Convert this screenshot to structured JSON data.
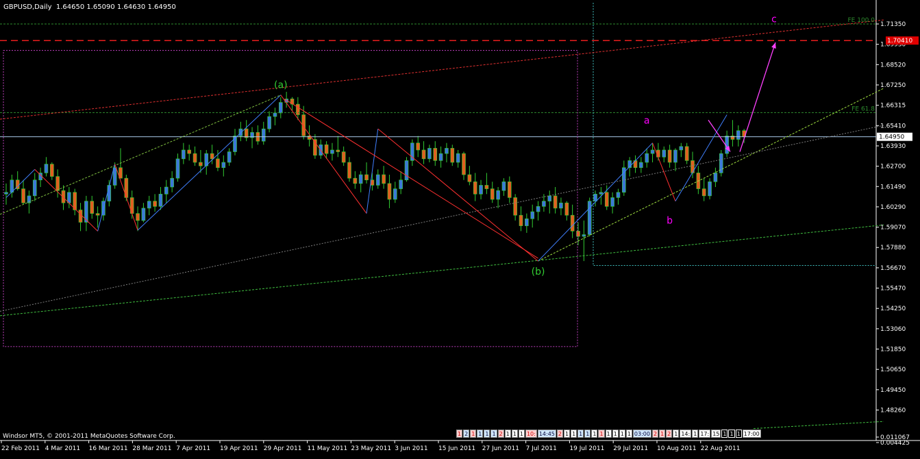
{
  "header": {
    "symbol_label": "GBPUSD,Daily",
    "ohlc_text": "1.64650 1.65090 1.64630 1.64950"
  },
  "footer": {
    "copyright": "Windsor MT5, © 2001-2011 MetaQuotes Software Corp."
  },
  "chart_data": {
    "type": "candlestick",
    "symbol": "GBPUSD",
    "timeframe": "Daily",
    "ylim": [
      1.486,
      1.72
    ],
    "y_ticks": [
      "1.71350",
      "1.69930",
      "1.68520",
      "1.67250",
      "1.66315",
      "1.65410",
      "1.63930",
      "1.62700",
      "1.61490",
      "1.60290",
      "1.59070",
      "1.57880",
      "1.56670",
      "1.55470",
      "1.54250",
      "1.53060",
      "1.51850",
      "1.50650",
      "1.49450",
      "1.48260",
      "0.011067",
      "0.004425"
    ],
    "x_tick_labels": [
      "22 Feb 2011",
      "4 Mar 2011",
      "16 Mar 2011",
      "28 Mar 2011",
      "7 Apr 2011",
      "19 Apr 2011",
      "29 Apr 2011",
      "11 May 2011",
      "23 May 2011",
      "3 Jun 2011",
      "15 Jun 2011",
      "27 Jun 2011",
      "7 Jul 2011",
      "19 Jul 2011",
      "29 Jul 2011",
      "10 Aug 2011",
      "22 Aug 2011"
    ],
    "last_price_label": "1.64950",
    "last_price": 1.6495,
    "level_labels": [
      {
        "text": "FE 100.0",
        "value": 1.7135
      },
      {
        "text": "FE 61.8",
        "value": 1.6632
      },
      {
        "text": "1.70410",
        "value": 1.7041
      }
    ],
    "wave_labels": [
      {
        "text": "(a)",
        "date": "27 Apr 2011",
        "price": 1.6732,
        "color": "#32cd32"
      },
      {
        "text": "(b)",
        "date": "7 Jul 2011",
        "price": 1.579,
        "color": "#32cd32"
      },
      {
        "text": "a",
        "date": "29 Jul 2011",
        "price": 1.657,
        "color": "#ff00ff"
      },
      {
        "text": "b",
        "date": "11 Aug 2011",
        "price": 1.6025,
        "color": "#ff00ff"
      },
      {
        "text": "c",
        "date": "1 Sep 2011",
        "price": 1.7145,
        "color": "#ff00ff"
      }
    ],
    "ohlc": [
      [
        1.617,
        1.623,
        1.611,
        1.618
      ],
      [
        1.618,
        1.628,
        1.615,
        1.625
      ],
      [
        1.625,
        1.63,
        1.619,
        1.62
      ],
      [
        1.62,
        1.625,
        1.611,
        1.612
      ],
      [
        1.612,
        1.619,
        1.606,
        1.616
      ],
      [
        1.616,
        1.629,
        1.613,
        1.625
      ],
      [
        1.625,
        1.632,
        1.621,
        1.629
      ],
      [
        1.629,
        1.638,
        1.627,
        1.634
      ],
      [
        1.634,
        1.635,
        1.625,
        1.627
      ],
      [
        1.627,
        1.631,
        1.615,
        1.619
      ],
      [
        1.619,
        1.622,
        1.608,
        1.612
      ],
      [
        1.612,
        1.621,
        1.609,
        1.618
      ],
      [
        1.618,
        1.62,
        1.605,
        1.608
      ],
      [
        1.608,
        1.612,
        1.596,
        1.601
      ],
      [
        1.601,
        1.616,
        1.596,
        1.613
      ],
      [
        1.613,
        1.616,
        1.603,
        1.606
      ],
      [
        1.606,
        1.61,
        1.598,
        1.605
      ],
      [
        1.605,
        1.615,
        1.602,
        1.613
      ],
      [
        1.613,
        1.625,
        1.61,
        1.622
      ],
      [
        1.622,
        1.635,
        1.62,
        1.632
      ],
      [
        1.632,
        1.643,
        1.629,
        1.626
      ],
      [
        1.626,
        1.628,
        1.613,
        1.615
      ],
      [
        1.615,
        1.619,
        1.603,
        1.606
      ],
      [
        1.606,
        1.61,
        1.596,
        1.602
      ],
      [
        1.602,
        1.612,
        1.601,
        1.609
      ],
      [
        1.609,
        1.616,
        1.605,
        1.613
      ],
      [
        1.613,
        1.617,
        1.607,
        1.61
      ],
      [
        1.61,
        1.621,
        1.608,
        1.617
      ],
      [
        1.617,
        1.625,
        1.612,
        1.621
      ],
      [
        1.621,
        1.63,
        1.618,
        1.626
      ],
      [
        1.626,
        1.64,
        1.624,
        1.637
      ],
      [
        1.637,
        1.646,
        1.634,
        1.642
      ],
      [
        1.642,
        1.645,
        1.636,
        1.64
      ],
      [
        1.64,
        1.644,
        1.633,
        1.635
      ],
      [
        1.635,
        1.642,
        1.629,
        1.633
      ],
      [
        1.633,
        1.642,
        1.628,
        1.64
      ],
      [
        1.64,
        1.645,
        1.634,
        1.637
      ],
      [
        1.637,
        1.642,
        1.63,
        1.632
      ],
      [
        1.632,
        1.639,
        1.627,
        1.635
      ],
      [
        1.635,
        1.643,
        1.633,
        1.641
      ],
      [
        1.641,
        1.654,
        1.639,
        1.65
      ],
      [
        1.65,
        1.658,
        1.647,
        1.654
      ],
      [
        1.654,
        1.659,
        1.647,
        1.649
      ],
      [
        1.649,
        1.655,
        1.643,
        1.652
      ],
      [
        1.652,
        1.656,
        1.645,
        1.647
      ],
      [
        1.647,
        1.658,
        1.645,
        1.654
      ],
      [
        1.654,
        1.664,
        1.652,
        1.661
      ],
      [
        1.661,
        1.666,
        1.656,
        1.663
      ],
      [
        1.663,
        1.672,
        1.66,
        1.669
      ],
      [
        1.669,
        1.675,
        1.666,
        1.671
      ],
      [
        1.671,
        1.672,
        1.664,
        1.668
      ],
      [
        1.668,
        1.672,
        1.659,
        1.662
      ],
      [
        1.662,
        1.667,
        1.648,
        1.65
      ],
      [
        1.65,
        1.656,
        1.644,
        1.648
      ],
      [
        1.648,
        1.651,
        1.637,
        1.639
      ],
      [
        1.639,
        1.648,
        1.637,
        1.645
      ],
      [
        1.645,
        1.647,
        1.637,
        1.64
      ],
      [
        1.64,
        1.646,
        1.636,
        1.642
      ],
      [
        1.642,
        1.65,
        1.638,
        1.641
      ],
      [
        1.641,
        1.644,
        1.633,
        1.635
      ],
      [
        1.635,
        1.638,
        1.624,
        1.626
      ],
      [
        1.626,
        1.63,
        1.62,
        1.623
      ],
      [
        1.623,
        1.63,
        1.618,
        1.628
      ],
      [
        1.628,
        1.635,
        1.623,
        1.625
      ],
      [
        1.625,
        1.629,
        1.619,
        1.622
      ],
      [
        1.622,
        1.631,
        1.62,
        1.628
      ],
      [
        1.628,
        1.633,
        1.62,
        1.623
      ],
      [
        1.623,
        1.628,
        1.609,
        1.614
      ],
      [
        1.614,
        1.624,
        1.612,
        1.62
      ],
      [
        1.62,
        1.63,
        1.617,
        1.625
      ],
      [
        1.625,
        1.638,
        1.624,
        1.636
      ],
      [
        1.636,
        1.648,
        1.633,
        1.646
      ],
      [
        1.646,
        1.65,
        1.638,
        1.642
      ],
      [
        1.642,
        1.647,
        1.634,
        1.637
      ],
      [
        1.637,
        1.645,
        1.635,
        1.643
      ],
      [
        1.643,
        1.647,
        1.633,
        1.636
      ],
      [
        1.636,
        1.644,
        1.632,
        1.64
      ],
      [
        1.64,
        1.646,
        1.635,
        1.643
      ],
      [
        1.643,
        1.645,
        1.633,
        1.635
      ],
      [
        1.635,
        1.642,
        1.632,
        1.64
      ],
      [
        1.64,
        1.641,
        1.625,
        1.628
      ],
      [
        1.628,
        1.633,
        1.622,
        1.624
      ],
      [
        1.624,
        1.629,
        1.613,
        1.617
      ],
      [
        1.617,
        1.625,
        1.614,
        1.622
      ],
      [
        1.622,
        1.629,
        1.617,
        1.62
      ],
      [
        1.62,
        1.624,
        1.612,
        1.614
      ],
      [
        1.614,
        1.621,
        1.609,
        1.619
      ],
      [
        1.619,
        1.626,
        1.616,
        1.624
      ],
      [
        1.624,
        1.627,
        1.612,
        1.615
      ],
      [
        1.615,
        1.617,
        1.602,
        1.605
      ],
      [
        1.605,
        1.61,
        1.596,
        1.599
      ],
      [
        1.599,
        1.606,
        1.595,
        1.603
      ],
      [
        1.603,
        1.611,
        1.598,
        1.607
      ],
      [
        1.607,
        1.613,
        1.602,
        1.61
      ],
      [
        1.61,
        1.617,
        1.607,
        1.613
      ],
      [
        1.613,
        1.619,
        1.606,
        1.616
      ],
      [
        1.616,
        1.621,
        1.606,
        1.609
      ],
      [
        1.609,
        1.615,
        1.605,
        1.612
      ],
      [
        1.612,
        1.613,
        1.602,
        1.605
      ],
      [
        1.605,
        1.611,
        1.592,
        1.596
      ],
      [
        1.596,
        1.601,
        1.588,
        1.593
      ],
      [
        1.593,
        1.602,
        1.579,
        1.594
      ],
      [
        1.594,
        1.615,
        1.593,
        1.613
      ],
      [
        1.613,
        1.619,
        1.61,
        1.617
      ],
      [
        1.617,
        1.621,
        1.611,
        1.618
      ],
      [
        1.618,
        1.622,
        1.608,
        1.61
      ],
      [
        1.61,
        1.618,
        1.606,
        1.615
      ],
      [
        1.615,
        1.62,
        1.611,
        1.618
      ],
      [
        1.618,
        1.636,
        1.616,
        1.632
      ],
      [
        1.632,
        1.638,
        1.627,
        1.636
      ],
      [
        1.636,
        1.639,
        1.629,
        1.632
      ],
      [
        1.632,
        1.638,
        1.629,
        1.635
      ],
      [
        1.635,
        1.643,
        1.632,
        1.64
      ],
      [
        1.64,
        1.646,
        1.635,
        1.642
      ],
      [
        1.642,
        1.646,
        1.636,
        1.638
      ],
      [
        1.638,
        1.644,
        1.635,
        1.642
      ],
      [
        1.642,
        1.645,
        1.632,
        1.635
      ],
      [
        1.635,
        1.643,
        1.63,
        1.642
      ],
      [
        1.642,
        1.646,
        1.638,
        1.644
      ],
      [
        1.644,
        1.646,
        1.634,
        1.636
      ],
      [
        1.636,
        1.641,
        1.626,
        1.629
      ],
      [
        1.629,
        1.633,
        1.617,
        1.62
      ],
      [
        1.62,
        1.626,
        1.613,
        1.616
      ],
      [
        1.616,
        1.626,
        1.614,
        1.624
      ],
      [
        1.624,
        1.632,
        1.621,
        1.629
      ],
      [
        1.629,
        1.642,
        1.627,
        1.64
      ],
      [
        1.64,
        1.653,
        1.638,
        1.65
      ],
      [
        1.65,
        1.659,
        1.644,
        1.648
      ],
      [
        1.648,
        1.656,
        1.644,
        1.653
      ],
      [
        1.653,
        1.654,
        1.646,
        1.6495
      ]
    ]
  },
  "timebar": {
    "cells": [
      {
        "text": "1",
        "style": "red"
      },
      {
        "text": "2",
        "style": "blue"
      },
      {
        "text": "1",
        "style": "red"
      },
      {
        "text": "1",
        "style": "blue"
      },
      {
        "text": "1",
        "style": "blue"
      },
      {
        "text": "1",
        "style": "blue"
      },
      {
        "text": "2",
        "style": "red"
      },
      {
        "text": "1",
        "style": ""
      },
      {
        "text": "1",
        "style": ""
      },
      {
        "text": "1",
        "style": ""
      },
      {
        "text": "10:",
        "style": "red"
      },
      {
        "text": "14:45",
        "style": "blue"
      },
      {
        "text": "2",
        "style": "red"
      },
      {
        "text": "1",
        "style": ""
      },
      {
        "text": "1",
        "style": ""
      },
      {
        "text": "1",
        "style": "blue"
      },
      {
        "text": "1",
        "style": "blue"
      },
      {
        "text": "1",
        "style": ""
      },
      {
        "text": "1",
        "style": "red"
      },
      {
        "text": "1",
        "style": ""
      },
      {
        "text": "1",
        "style": ""
      },
      {
        "text": "1",
        "style": ""
      },
      {
        "text": "1",
        "style": ""
      },
      {
        "text": "03:00",
        "style": "blue"
      },
      {
        "text": "2",
        "style": "red"
      },
      {
        "text": "1",
        "style": "red"
      },
      {
        "text": "2",
        "style": "red"
      },
      {
        "text": "1",
        "style": ""
      },
      {
        "text": "14:",
        "style": ""
      },
      {
        "text": "1",
        "style": ""
      },
      {
        "text": "17:",
        "style": ""
      },
      {
        "text": "15",
        "style": ""
      },
      {
        "text": "1",
        "style": "sel"
      },
      {
        "text": "1",
        "style": "sel"
      },
      {
        "text": "1",
        "style": "sel"
      },
      {
        "text": "17:00",
        "style": ""
      }
    ]
  }
}
